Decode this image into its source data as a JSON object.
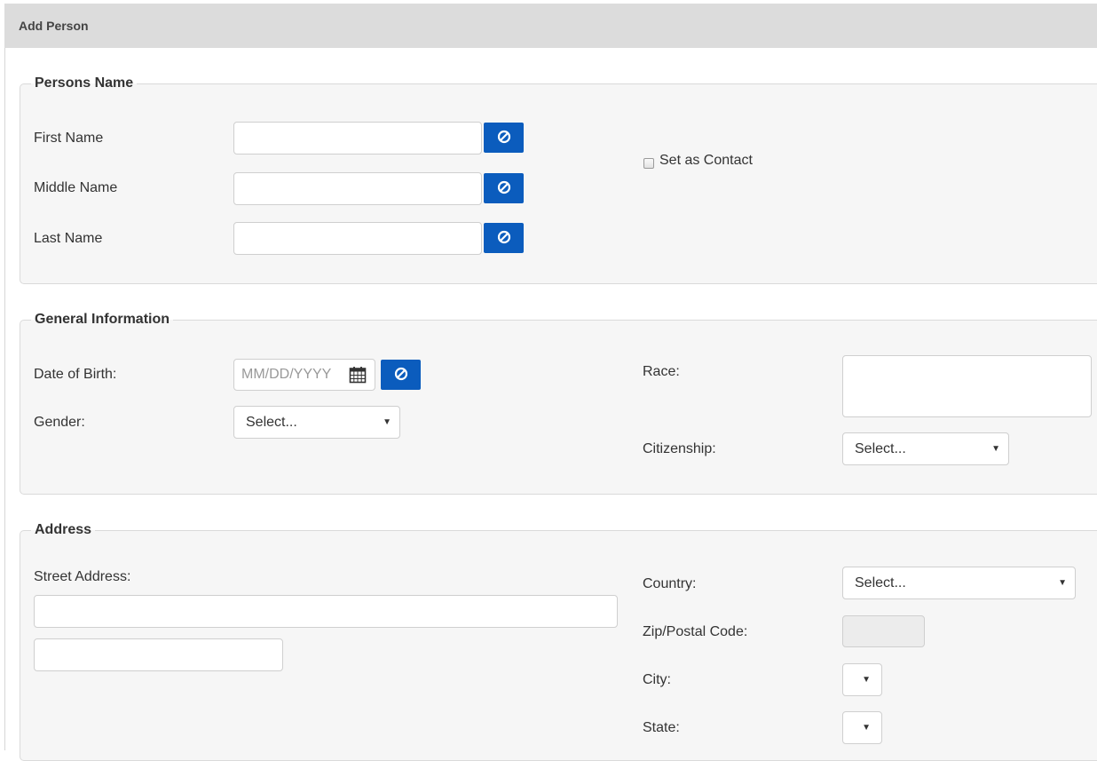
{
  "header": {
    "title": "Add Person"
  },
  "persons_name": {
    "legend": "Persons Name",
    "first_name_label": "First Name",
    "middle_name_label": "Middle Name",
    "last_name_label": "Last Name",
    "first_name_value": "",
    "middle_name_value": "",
    "last_name_value": "",
    "set_as_contact_label": "Set as Contact",
    "set_as_contact_checked": false
  },
  "general_information": {
    "legend": "General Information",
    "dob_label": "Date of Birth:",
    "dob_placeholder": "MM/DD/YYYY",
    "gender_label": "Gender:",
    "gender_selected": "Select...",
    "race_label": "Race:",
    "citizenship_label": "Citizenship:",
    "citizenship_selected": "Select..."
  },
  "address": {
    "legend": "Address",
    "street_label": "Street Address:",
    "street_line1_value": "",
    "street_line2_value": "",
    "country_label": "Country:",
    "country_selected": "Select...",
    "zip_label": "Zip/Postal Code:",
    "city_label": "City:",
    "city_selected": "",
    "state_label": "State:",
    "state_selected": ""
  },
  "icons": {
    "clear": "ban-icon",
    "calendar": "calendar-icon",
    "dropdown": "caret-down-icon"
  },
  "colors": {
    "header_bg": "#dcdcdc",
    "section_bg": "#f6f6f6",
    "button_blue": "#0b5cbd"
  }
}
